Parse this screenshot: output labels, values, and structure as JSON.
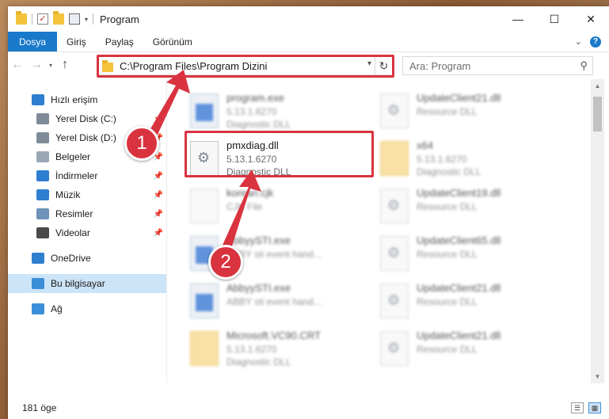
{
  "title_bar": {
    "title": "Program",
    "window_controls": [
      "minimize-icon",
      "maximize-icon",
      "close-icon"
    ],
    "ctrl_glyphs": {
      "min": "—",
      "max": "☐",
      "close": "✕"
    }
  },
  "ribbon": {
    "tabs": [
      "Dosya",
      "Giriş",
      "Paylaş",
      "Görünüm"
    ],
    "help_glyph": "?"
  },
  "address": {
    "path": "C:\\Program Files\\Program Dizini",
    "search_placeholder": "Ara: Program"
  },
  "nav_pane": {
    "items": [
      {
        "label": "Hızlı erişim",
        "icon": "star-icon",
        "color": "#2f7fd1",
        "pinned": false
      },
      {
        "label": "Yerel Disk (C:)",
        "icon": "drive-icon",
        "color": "#7f8b99",
        "pinned": true
      },
      {
        "label": "Yerel Disk (D:)",
        "icon": "drive-icon",
        "color": "#7f8b99",
        "pinned": true
      },
      {
        "label": "Belgeler",
        "icon": "documents-icon",
        "color": "#9aa7b6",
        "pinned": true
      },
      {
        "label": "İndirmeler",
        "icon": "download-icon",
        "color": "#2f7fd1",
        "pinned": true
      },
      {
        "label": "Müzik",
        "icon": "music-icon",
        "color": "#2f7fd1",
        "pinned": true
      },
      {
        "label": "Resimler",
        "icon": "pictures-icon",
        "color": "#6f93b8",
        "pinned": true
      },
      {
        "label": "Videolar",
        "icon": "videos-icon",
        "color": "#4a4a4a",
        "pinned": true
      },
      {
        "label": "OneDrive",
        "icon": "cloud-icon",
        "color": "#2f7fd1",
        "pinned": false
      },
      {
        "label": "Bu bilgisayar",
        "icon": "computer-icon",
        "color": "#3a8fd8",
        "pinned": false,
        "selected": true
      },
      {
        "label": "Ağ",
        "icon": "network-icon",
        "color": "#3a8fd8",
        "pinned": false
      }
    ]
  },
  "files": [
    {
      "name": "program.exe",
      "line2": "5.13.1.6270",
      "line3": "Diagnostic DLL",
      "icon": "exe",
      "blurred": true
    },
    {
      "name": "UpdateClient21.dll",
      "line2": "Resource DLL",
      "line3": "",
      "icon": "dll",
      "blurred": true
    },
    {
      "name": "pmxdiag.dll",
      "line2": "5.13.1.6270",
      "line3": "Diagnostic DLL",
      "icon": "dll",
      "blurred": false
    },
    {
      "name": "x64",
      "line2": "5.13.1.6270",
      "line3": "Diagnostic DLL",
      "icon": "fold",
      "blurred": true
    },
    {
      "name": "korean.cjk",
      "line2": "CJK File",
      "line3": "",
      "icon": "plain",
      "blurred": true
    },
    {
      "name": "UpdateClient19.dll",
      "line2": "Resource DLL",
      "line3": "",
      "icon": "dll",
      "blurred": true
    },
    {
      "name": "AbbyySTI.exe",
      "line2": "ABBY sti event hand...",
      "line3": "",
      "icon": "exe",
      "blurred": true
    },
    {
      "name": "UpdateClient65.dll",
      "line2": "Resource DLL",
      "line3": "",
      "icon": "dll",
      "blurred": true
    },
    {
      "name": "AbbyySTI.exe",
      "line2": "ABBY sti event hand...",
      "line3": "",
      "icon": "exe",
      "blurred": true
    },
    {
      "name": "UpdateClient21.dll",
      "line2": "Resource DLL",
      "line3": "",
      "icon": "dll",
      "blurred": true
    },
    {
      "name": "Microsoft.VC90.CRT",
      "line2": "5.13.1.6270",
      "line3": "Diagnostic DLL",
      "icon": "fold",
      "blurred": true
    },
    {
      "name": "UpdateClient21.dll",
      "line2": "Resource DLL",
      "line3": "",
      "icon": "dll",
      "blurred": true
    }
  ],
  "status_bar": {
    "item_count": "181 öge"
  },
  "annotations": {
    "badge_1": "1",
    "badge_2": "2",
    "highlight_color": "#d9333f"
  }
}
